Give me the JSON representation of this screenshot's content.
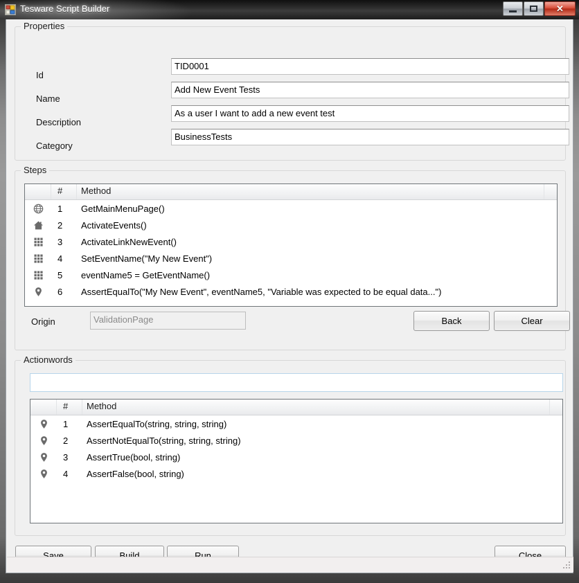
{
  "window": {
    "title": "Tesware Script Builder",
    "icon": "app-window-icon",
    "caption": {
      "minimize": "minimize-icon",
      "maximize": "maximize-icon",
      "close": "✕"
    }
  },
  "properties": {
    "group_title": "Properties",
    "fields": [
      {
        "label": "Id",
        "value": "TID0001"
      },
      {
        "label": "Name",
        "value": "Add New Event Tests"
      },
      {
        "label": "Description",
        "value": "As a user I want to add a new event test"
      },
      {
        "label": "Category",
        "value": "BusinessTests"
      }
    ]
  },
  "steps": {
    "group_title": "Steps",
    "columns": {
      "icon": "",
      "num": "#",
      "method": "Method"
    },
    "rows": [
      {
        "icon": "globe-icon",
        "num": "1",
        "method": "GetMainMenuPage()"
      },
      {
        "icon": "home-icon",
        "num": "2",
        "method": "ActivateEvents()"
      },
      {
        "icon": "grid-icon",
        "num": "3",
        "method": "ActivateLinkNewEvent()"
      },
      {
        "icon": "grid-icon",
        "num": "4",
        "method": "SetEventName(\"My New Event\")"
      },
      {
        "icon": "grid-icon",
        "num": "5",
        "method": "eventName5 = GetEventName()"
      },
      {
        "icon": "pin-icon",
        "num": "6",
        "method": "AssertEqualTo(\"My New Event\", eventName5, \"Variable was expected to be equal data...\")"
      }
    ],
    "origin_label": "Origin",
    "origin_value": "ValidationPage",
    "back_label": "Back",
    "clear_label": "Clear"
  },
  "actionwords": {
    "group_title": "Actionwords",
    "search_value": "",
    "search_placeholder": "",
    "columns": {
      "icon": "",
      "num": "#",
      "method": "Method"
    },
    "rows": [
      {
        "icon": "pin-icon",
        "num": "1",
        "method": "AssertEqualTo(string, string, string)"
      },
      {
        "icon": "pin-icon",
        "num": "2",
        "method": "AssertNotEqualTo(string, string, string)"
      },
      {
        "icon": "pin-icon",
        "num": "3",
        "method": "AssertTrue(bool, string)"
      },
      {
        "icon": "pin-icon",
        "num": "4",
        "method": "AssertFalse(bool, string)"
      }
    ]
  },
  "footer": {
    "save_label": "Save",
    "build_label": "Build",
    "run_label": "Run",
    "close_label": "Close"
  }
}
